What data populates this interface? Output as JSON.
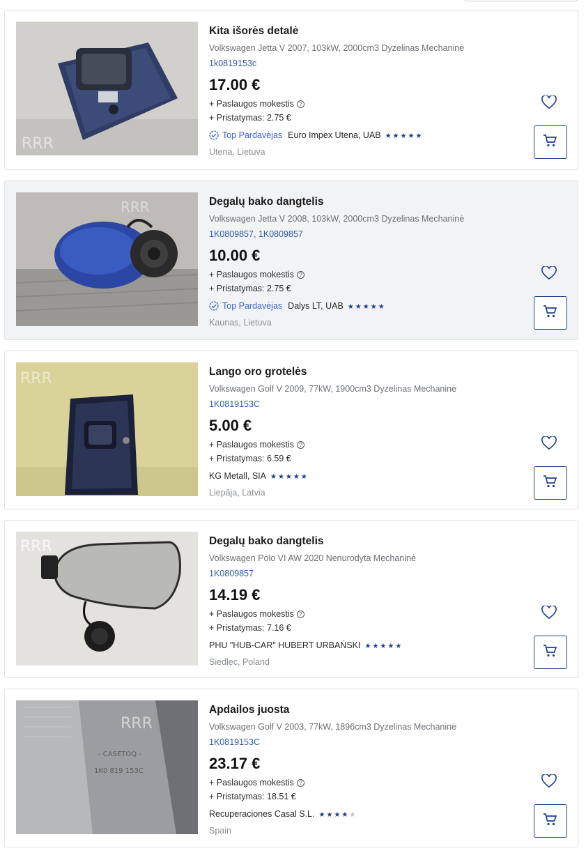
{
  "listings": [
    {
      "title": "Kita išorės detalė",
      "vehicle": "Volkswagen Jetta V 2007, 103kW, 2000cm3 Dyzelinas Mechaninė",
      "codes": [
        "1k0819153c"
      ],
      "price": "17.00 €",
      "service_fee": "+ Paslaugos mokestis",
      "shipping": "+ Pristatymas: 2.75 €",
      "top_seller": "Top Pardavėjas",
      "seller": "Euro Impex Utena, UAB",
      "rating": 5,
      "location": "Utena, Lietuva"
    },
    {
      "title": "Degalų bako dangtelis",
      "vehicle": "Volkswagen Jetta V 2008, 103kW, 2000cm3 Dyzelinas Mechaninė",
      "codes": [
        "1K0809857",
        "1K0809857"
      ],
      "price": "10.00 €",
      "service_fee": "+ Paslaugos mokestis",
      "shipping": "+ Pristatymas: 2.75 €",
      "top_seller": "Top Pardavėjas",
      "seller": "Dalys LT, UAB",
      "rating": 5,
      "location": "Kaunas, Lietuva"
    },
    {
      "title": "Lango oro grotelės",
      "vehicle": "Volkswagen Golf V 2009, 77kW, 1900cm3 Dyzelinas Mechaninė",
      "codes": [
        "1K0819153C"
      ],
      "price": "5.00 €",
      "service_fee": "+ Paslaugos mokestis",
      "shipping": "+ Pristatymas: 6.59 €",
      "top_seller": "",
      "seller": "KG Metall, SIA",
      "rating": 5,
      "location": "Liepāja, Latvia"
    },
    {
      "title": "Degalų bako dangtelis",
      "vehicle": "Volkswagen Polo VI AW 2020 Nenurodyta Mechaninė",
      "codes": [
        "1K0809857"
      ],
      "price": "14.19 €",
      "service_fee": "+ Paslaugos mokestis",
      "shipping": "+ Pristatymas: 7.16 €",
      "top_seller": "",
      "seller": "PHU \"HUB-CAR\" HUBERT URBAŃSKI",
      "rating": 5,
      "location": "Siedlec, Poland"
    },
    {
      "title": "Apdailos juosta",
      "vehicle": "Volkswagen Golf V 2003, 77kW, 1896cm3 Dyzelinas Mechaninė",
      "codes": [
        "1K0819153C"
      ],
      "price": "23.17 €",
      "service_fee": "+ Paslaugos mokestis",
      "shipping": "+ Pristatymas: 18.51 €",
      "top_seller": "",
      "seller": "Recuperaciones Casal S.L.",
      "rating": 4,
      "location": "Spain"
    }
  ],
  "colors": {
    "link": "#2d5aa6",
    "top_seller": "#3d63d6",
    "stars": "#1f3f8a",
    "card_highlight": "#f2f3f5"
  },
  "icons": {
    "fee_info": "question-circle-icon",
    "top_seller": "check-badge-icon",
    "favorite": "heart-icon",
    "cart": "shopping-cart-icon"
  }
}
